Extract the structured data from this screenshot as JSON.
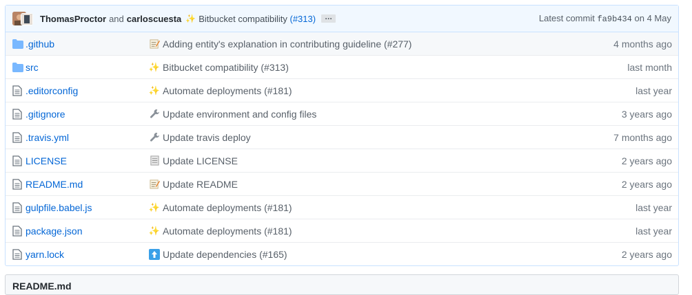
{
  "commit": {
    "author1": "ThomasProctor",
    "and_text": "and",
    "author2": "carloscuesta",
    "message": "Bitbucket compatibility",
    "pr": "(#313)",
    "ellipsis": "…",
    "latest_label": "Latest commit",
    "sha": "fa9b434",
    "date": "on 4 May"
  },
  "files": [
    {
      "type": "folder",
      "name": ".github",
      "emoji": "memo",
      "message": "Adding entity's explanation in contributing guideline (#277)",
      "age": "4 months ago"
    },
    {
      "type": "folder",
      "name": "src",
      "emoji": "sparkles",
      "message": "Bitbucket compatibility (#313)",
      "age": "last month"
    },
    {
      "type": "file",
      "name": ".editorconfig",
      "emoji": "sparkles",
      "message": "Automate deployments (#181)",
      "age": "last year"
    },
    {
      "type": "file",
      "name": ".gitignore",
      "emoji": "wrench",
      "message": "Update environment and config files",
      "age": "3 years ago"
    },
    {
      "type": "file",
      "name": ".travis.yml",
      "emoji": "wrench",
      "message": "Update travis deploy",
      "age": "7 months ago"
    },
    {
      "type": "file",
      "name": "LICENSE",
      "emoji": "page",
      "message": "Update LICENSE",
      "age": "2 years ago"
    },
    {
      "type": "file",
      "name": "README.md",
      "emoji": "memo",
      "message": "Update README",
      "age": "2 years ago"
    },
    {
      "type": "file",
      "name": "gulpfile.babel.js",
      "emoji": "sparkles",
      "message": "Automate deployments (#181)",
      "age": "last year"
    },
    {
      "type": "file",
      "name": "package.json",
      "emoji": "sparkles",
      "message": "Automate deployments (#181)",
      "age": "last year"
    },
    {
      "type": "file",
      "name": "yarn.lock",
      "emoji": "arrow-up",
      "message": "Update dependencies (#165)",
      "age": "2 years ago"
    }
  ],
  "readme": {
    "title": "README.md"
  },
  "colors": {
    "link": "#0366d6",
    "folder": "#79b8ff",
    "file_icon": "#6a737d",
    "commit_bg": "#f1f8ff"
  }
}
